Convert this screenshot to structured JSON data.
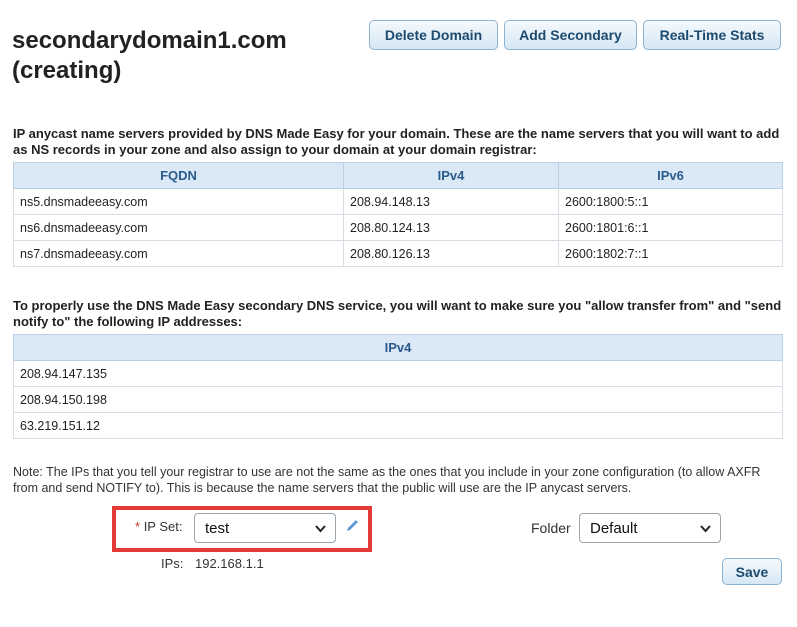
{
  "header": {
    "title_line1": "secondarydomain1.com",
    "title_line2": "(creating)",
    "buttons": {
      "delete_domain": "Delete Domain",
      "add_secondary": "Add Secondary",
      "realtime_stats": "Real-Time Stats"
    }
  },
  "nameservers": {
    "intro": "IP anycast name servers provided by DNS Made Easy for your domain. These are the name servers that you will want to add as NS records in your zone and also assign to your domain at your domain registrar:",
    "columns": [
      "FQDN",
      "IPv4",
      "IPv6"
    ],
    "rows": [
      [
        "ns5.dnsmadeeasy.com",
        "208.94.148.13",
        "2600:1800:5::1"
      ],
      [
        "ns6.dnsmadeeasy.com",
        "208.80.124.13",
        "2600:1801:6::1"
      ],
      [
        "ns7.dnsmadeeasy.com",
        "208.80.126.13",
        "2600:1802:7::1"
      ]
    ]
  },
  "transfer": {
    "intro": "To properly use the DNS Made Easy secondary DNS service, you will want to make sure you \"allow transfer from\" and \"send notify to\" the following IP addresses:",
    "column": "IPv4",
    "rows": [
      "208.94.147.135",
      "208.94.150.198",
      "63.219.151.12"
    ]
  },
  "note": "Note: The IPs that you tell your registrar to use are not the same as the ones that you include in your zone configuration (to allow AXFR from and send NOTIFY to). This is because the name servers that the public will use are the IP anycast servers.",
  "form": {
    "ipset_required": "*",
    "ipset_label": "IP Set:",
    "ipset_value": "test",
    "ips_label": "IPs:",
    "ips_value": "192.168.1.1",
    "folder_label": "Folder",
    "folder_value": "Default",
    "save_label": "Save"
  },
  "colors": {
    "highlight": "#e53935",
    "header_bg": "#dbe8f5",
    "header_text": "#2a5b8c",
    "button_text": "#1e4a6e"
  },
  "icons": [
    "chevron-down-icon",
    "pencil-icon"
  ]
}
